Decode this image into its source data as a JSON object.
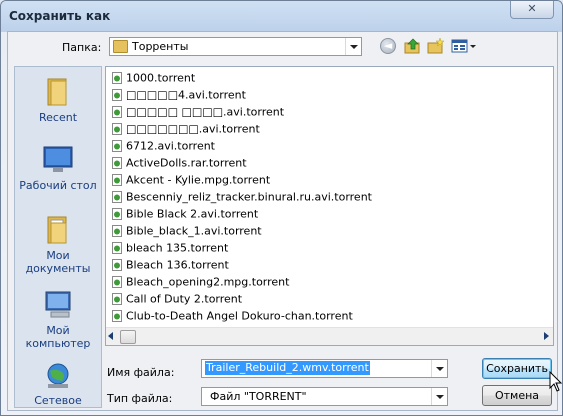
{
  "window": {
    "title": "Сохранить как",
    "close_label": "✕"
  },
  "toolbar": {
    "folder_label": "Папка:",
    "folder_name": "Торренты",
    "icons": [
      "back-icon",
      "up-folder-icon",
      "new-folder-icon",
      "views-menu-icon"
    ]
  },
  "places": [
    {
      "label": "Recent",
      "icon": "recent-folder-icon"
    },
    {
      "label": "Рабочий стол",
      "icon": "desktop-icon"
    },
    {
      "label": "Мои документы",
      "icon": "documents-folder-icon"
    },
    {
      "label": "Мой компьютер",
      "icon": "computer-icon"
    },
    {
      "label": "Сетевое",
      "icon": "network-icon"
    }
  ],
  "files": [
    "1000.torrent",
    "□□□□□4.avi.torrent",
    "□□□□□ □□□□.avi.torrent",
    "□□□□□□□.avi.torrent",
    "6712.avi.torrent",
    "ActiveDolls.rar.torrent",
    "Akcent - Kylie.mpg.torrent",
    "Bescenniy_reliz_tracker.binural.ru.avi.torrent",
    "Bible Black 2.avi.torrent",
    "Bible_black_1.avi.torrent",
    "bleach 135.torrent",
    "Bleach 136.torrent",
    "Bleach_opening2.mpg.torrent",
    "Call of Duty 2.torrent",
    "Club-to-Death Angel Dokuro-chan.torrent"
  ],
  "form": {
    "filename_label": "Имя файла:",
    "filename_value": "Trailer_Rebuild_2.wmv.torrent",
    "filetype_label": "Тип файла:",
    "filetype_value": "Файл \"TORRENT\""
  },
  "buttons": {
    "save_label": "Сохранить",
    "cancel_label": "Отмена"
  },
  "colors": {
    "selection": "#3399ff",
    "places_text": "#1a3e80",
    "default_button": "#bee6fd"
  }
}
